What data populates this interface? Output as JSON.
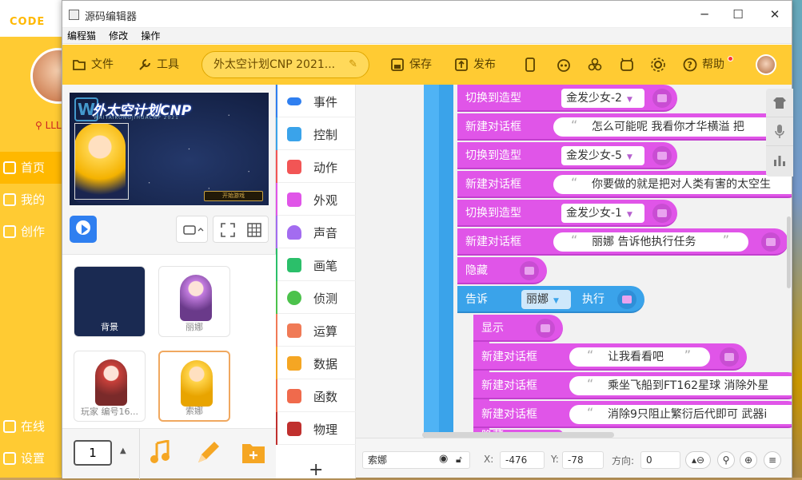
{
  "background_app": {
    "logo": "CODE",
    "username": "LLL",
    "nav": [
      "首页",
      "我的",
      "创作",
      "在线",
      "设置"
    ]
  },
  "window": {
    "title": "源码编辑器",
    "menu": [
      "编程猫",
      "修改",
      "操作"
    ]
  },
  "toolbar": {
    "file": "文件",
    "tools": "工具",
    "project_name": "外太空计划CNP 2021...",
    "save": "保存",
    "publish": "发布",
    "help": "帮助"
  },
  "stage": {
    "title": "外太空计划CNP",
    "subtitle": "WAITAIKONGJIHUACNP 2021",
    "start_button": "开始游戏"
  },
  "sprites": [
    {
      "name": "背景"
    },
    {
      "name": "丽娜"
    },
    {
      "name": "玩家 编号16..."
    },
    {
      "name": "索娜"
    }
  ],
  "bottom": {
    "scene_number": "1"
  },
  "categories": [
    {
      "label": "事件",
      "color": "#2f7ff0"
    },
    {
      "label": "控制",
      "color": "#3aa3ea"
    },
    {
      "label": "动作",
      "color": "#f25555"
    },
    {
      "label": "外观",
      "color": "#e055e8"
    },
    {
      "label": "声音",
      "color": "#a36cf0"
    },
    {
      "label": "画笔",
      "color": "#2bbf6a"
    },
    {
      "label": "侦测",
      "color": "#4cc24c"
    },
    {
      "label": "运算",
      "color": "#f07a56"
    },
    {
      "label": "数据",
      "color": "#f5a623"
    },
    {
      "label": "函数",
      "color": "#f06a4c"
    },
    {
      "label": "物理",
      "color": "#c0302e"
    }
  ],
  "code_blocks": {
    "switch_costume": "切换到造型",
    "new_dialog": "新建对话框",
    "hide": "隐藏",
    "show": "显示",
    "tell": "告诉",
    "execute": "执行",
    "costume1": "金发少女-2",
    "dialog1": "怎么可能呢 我看你才华横溢 把",
    "costume2": "金发少女-5",
    "dialog2": "你要做的就是把对人类有害的太空生",
    "costume3": "金发少女-1",
    "dialog3": "丽娜 告诉他执行任务",
    "tell_target": "丽娜",
    "dialog4": "让我看看吧",
    "dialog5": "乘坐飞船到FT162星球 消除外星",
    "dialog6": "消除9只阻止繁衍后代即可  武器i",
    "hide2": "隐藏"
  },
  "status": {
    "sprite_name": "索娜",
    "x_label": "X:",
    "x_value": "-476",
    "y_label": "Y:",
    "y_value": "-78",
    "dir_label": "方向:",
    "dir_value": "0"
  }
}
